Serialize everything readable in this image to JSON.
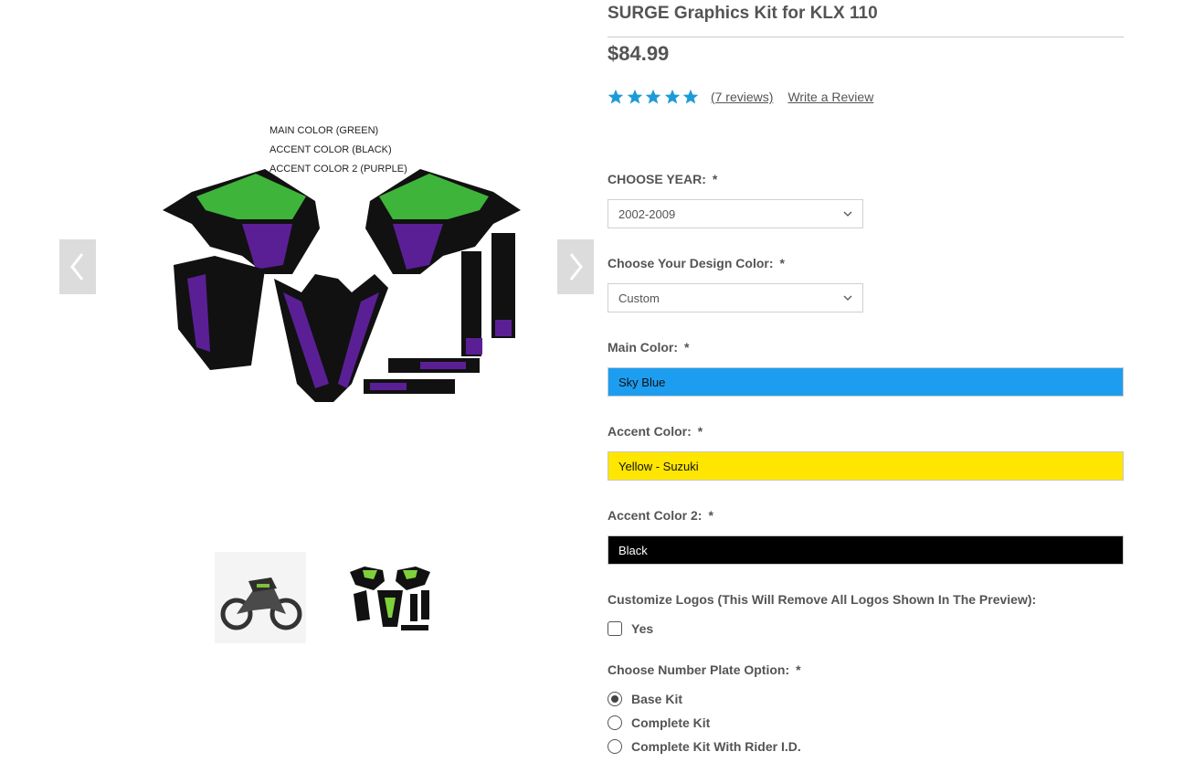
{
  "product": {
    "title": "SURGE Graphics Kit for KLX 110",
    "price": "$84.99",
    "rating_stars": 5,
    "reviews_link": "(7 reviews)",
    "write_review": "Write a Review",
    "star_color": "#1e9bd7"
  },
  "gallery": {
    "captions": [
      "MAIN COLOR (GREEN)",
      "ACCENT COLOR (BLACK)",
      "ACCENT COLOR 2 (PURPLE)"
    ],
    "prev_icon": "chevron-left-icon",
    "next_icon": "chevron-right-icon",
    "thumbnails": [
      "dirt-bike-photo",
      "graphics-kit-layout"
    ]
  },
  "options": {
    "year": {
      "label": "CHOOSE YEAR:",
      "required": "*",
      "value": "2002-2009"
    },
    "design_color": {
      "label": "Choose Your Design Color:",
      "required": "*",
      "value": "Custom"
    },
    "main_color": {
      "label": "Main Color:",
      "required": "*",
      "value": "Sky Blue",
      "bg": "#1c9df0",
      "fg": "#111111"
    },
    "accent_color": {
      "label": "Accent Color:",
      "required": "*",
      "value": "Yellow - Suzuki",
      "bg": "#ffe600",
      "fg": "#111111"
    },
    "accent_color_2": {
      "label": "Accent Color 2:",
      "required": "*",
      "value": "Black",
      "bg": "#000000",
      "fg": "#ffffff"
    },
    "customize_logos": {
      "label": "Customize Logos (This Will Remove All Logos Shown In The Preview):",
      "checkbox_label": "Yes",
      "checked": false
    },
    "number_plate": {
      "label": "Choose Number Plate Option:",
      "required": "*",
      "choices": [
        "Base Kit",
        "Complete Kit",
        "Complete Kit With Rider I.D."
      ],
      "selected": "Base Kit"
    }
  }
}
